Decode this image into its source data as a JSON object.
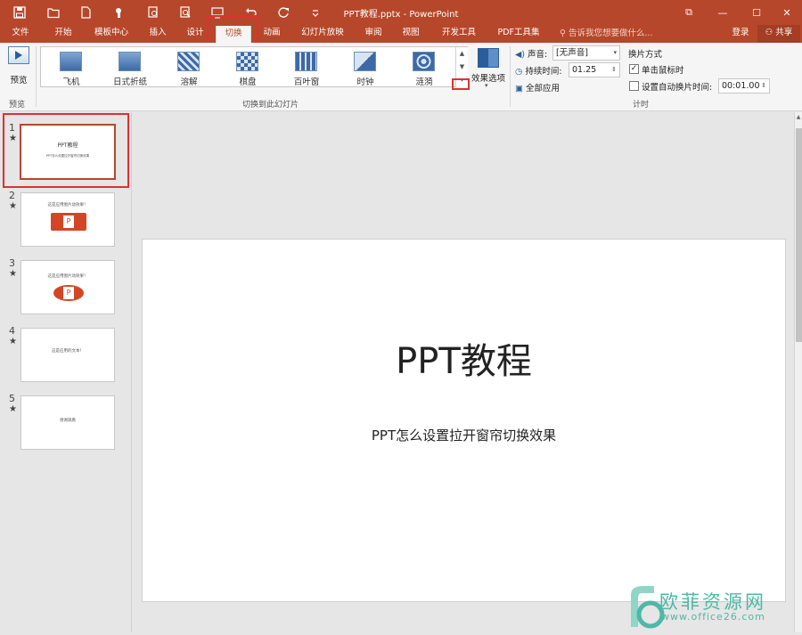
{
  "app": {
    "title": "PPT教程.pptx - PowerPoint"
  },
  "quick_access": [
    "save-icon",
    "open-icon",
    "new-icon",
    "touch-mode-icon",
    "print-preview-icon",
    "present-icon",
    "undo-icon",
    "redo-icon",
    "customize-icon"
  ],
  "window": {
    "restore_label": "⧉",
    "minimize_label": "—",
    "maximize_label": "☐",
    "close_label": "✕"
  },
  "tabs": [
    {
      "label": "文件"
    },
    {
      "label": "开始"
    },
    {
      "label": "模板中心"
    },
    {
      "label": "插入"
    },
    {
      "label": "设计"
    },
    {
      "label": "切换"
    },
    {
      "label": "动画"
    },
    {
      "label": "幻灯片放映"
    },
    {
      "label": "审阅"
    },
    {
      "label": "视图"
    },
    {
      "label": "开发工具"
    },
    {
      "label": "PDF工具集"
    }
  ],
  "active_tab": "切换",
  "tellme": "告诉我您想要做什么...",
  "account": {
    "login": "登录",
    "share": "共享"
  },
  "ribbon": {
    "preview": {
      "label": "预览",
      "group": "预览"
    },
    "transitions": {
      "group": "切换到此幻灯片",
      "items": [
        {
          "label": "飞机"
        },
        {
          "label": "日式折纸"
        },
        {
          "label": "溶解"
        },
        {
          "label": "棋盘"
        },
        {
          "label": "百叶窗"
        },
        {
          "label": "时钟"
        },
        {
          "label": "涟漪"
        }
      ],
      "effect_options": "效果选项"
    },
    "timing": {
      "group": "计时",
      "sound_label": "声音:",
      "sound_value": "[无声音]",
      "duration_label": "持续时间:",
      "duration_value": "01.25",
      "apply_all": "全部应用",
      "advance_heading": "换片方式",
      "on_click_label": "单击鼠标时",
      "on_click_checked": true,
      "after_label": "设置自动换片时间:",
      "after_checked": false,
      "after_value": "00:01.00"
    }
  },
  "slides": [
    {
      "num": "1",
      "star": "★",
      "title": "PPT教程",
      "subtitle": "PPT怎么设置拉开窗帘切换效果"
    },
    {
      "num": "2",
      "star": "★",
      "title": "这是应用图片动效果！"
    },
    {
      "num": "3",
      "star": "★",
      "title": "这是应用图片动效果！"
    },
    {
      "num": "4",
      "star": "★",
      "title": "这是应用的文本！"
    },
    {
      "num": "5",
      "star": "★",
      "title": "感谢观看"
    }
  ],
  "current_slide": {
    "title": "PPT教程",
    "subtitle": "PPT怎么设置拉开窗帘切换效果"
  },
  "watermark": {
    "text": "欧菲资源网",
    "url": "www.office26.com"
  },
  "colors": {
    "accent": "#b7472a",
    "highlight": "#e03030"
  }
}
